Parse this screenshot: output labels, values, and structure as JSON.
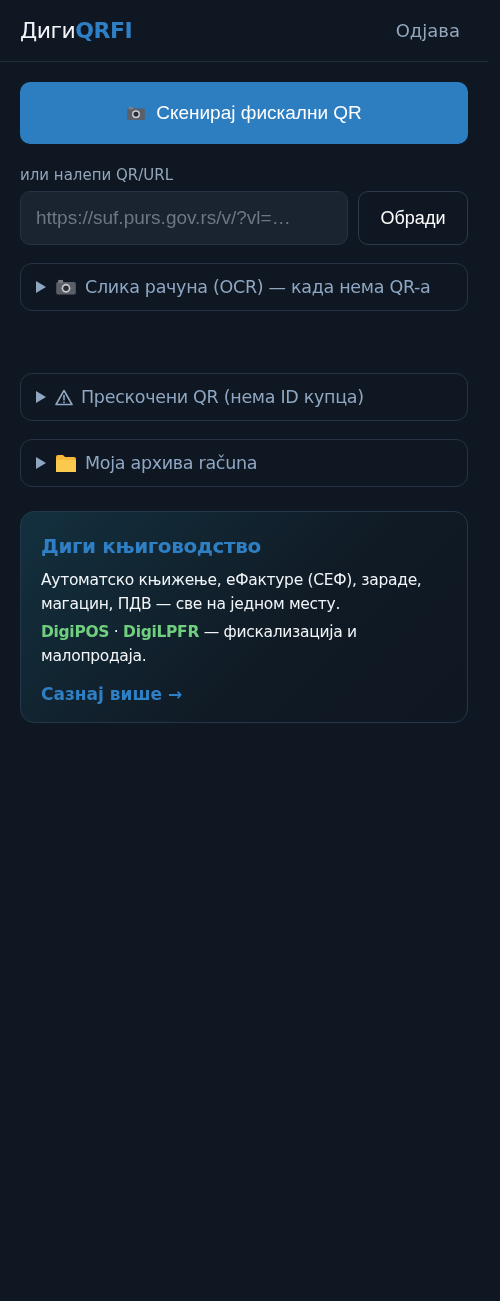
{
  "header": {
    "logo": "Диги**QRFI**",
    "logout": "Одјава"
  },
  "scan_button": {
    "label": "Скенирај фискални QR"
  },
  "paste": {
    "label": "или налепи QR/URL",
    "placeholder": "https://suf.purs.gov.rs/v/?vl=…",
    "button": "Обради"
  },
  "sections": [
    {
      "kind": "camera",
      "label": "Слика рачуна (OCR) — када нема QR-а",
      "expanded": false
    },
    {
      "kind": "warning",
      "label": "Прескочени QR (нема ID купца)",
      "expanded": false
    },
    {
      "kind": "folder",
      "label": "Моја архива računa",
      "expanded": false
    }
  ],
  "promo": {
    "title": "Диги књиговодство",
    "text": "Аутоматско књижење, еФактуре (СЕФ), зараде, магацин, ПДВ — све на једном месту.",
    "products": "**DigiPOS** · **DigiLPFR** — фискализација и малопродаја.",
    "link": "Сазнај више →"
  }
}
